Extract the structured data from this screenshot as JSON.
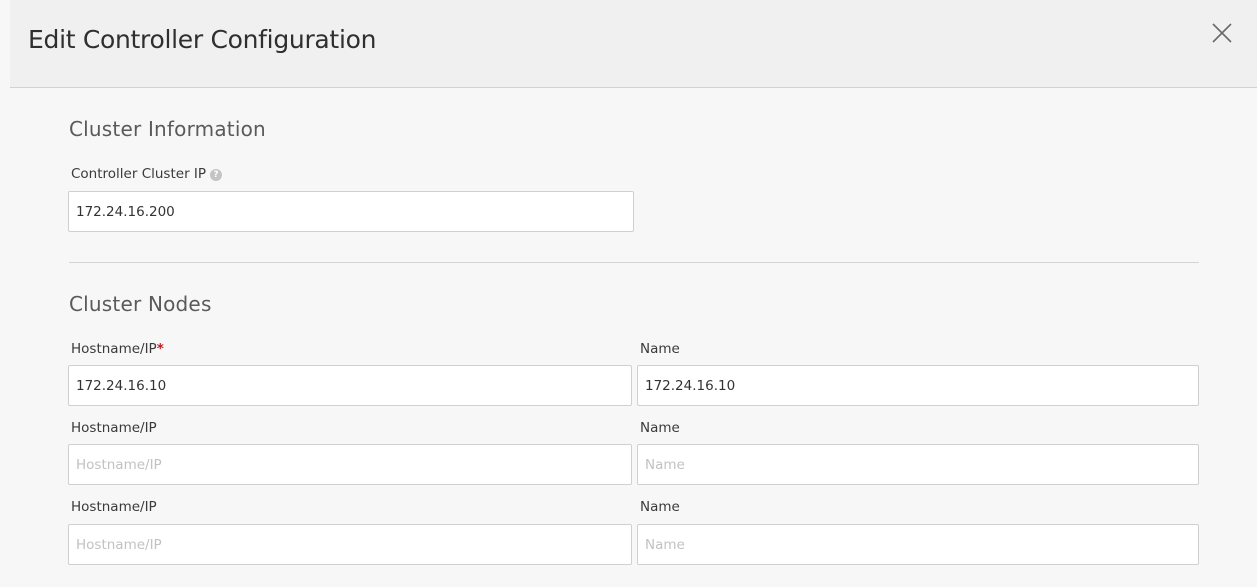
{
  "modal": {
    "title": "Edit Controller Configuration",
    "close_icon": "close-icon"
  },
  "cluster_info": {
    "section_title": "Cluster Information",
    "cluster_ip_label": "Controller Cluster IP",
    "cluster_ip_help_icon": "question-circle-icon",
    "cluster_ip_value": "172.24.16.200"
  },
  "cluster_nodes": {
    "section_title": "Cluster Nodes",
    "required_marker": "*",
    "nodes": [
      {
        "hostname_label": "Hostname/IP",
        "hostname_value": "172.24.16.10",
        "hostname_placeholder": "Hostname/IP",
        "name_label": "Name",
        "name_value": "172.24.16.10",
        "name_placeholder": "Name",
        "required": true
      },
      {
        "hostname_label": "Hostname/IP",
        "hostname_value": "",
        "hostname_placeholder": "Hostname/IP",
        "name_label": "Name",
        "name_value": "",
        "name_placeholder": "Name",
        "required": false
      },
      {
        "hostname_label": "Hostname/IP",
        "hostname_value": "",
        "hostname_placeholder": "Hostname/IP",
        "name_label": "Name",
        "name_value": "",
        "name_placeholder": "Name",
        "required": false
      }
    ]
  }
}
